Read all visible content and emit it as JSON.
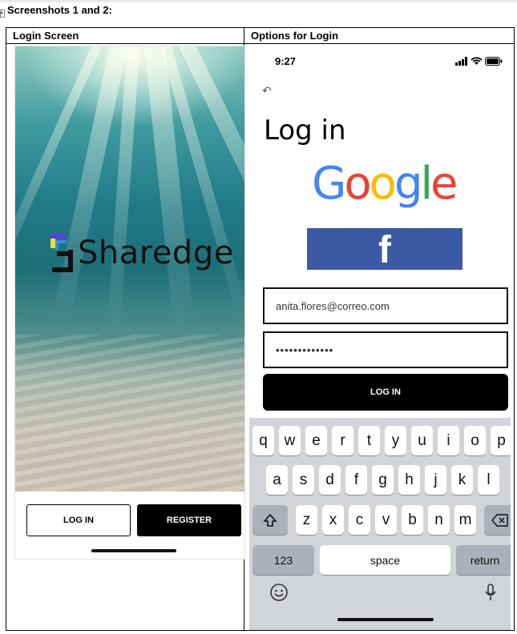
{
  "document": {
    "heading": "Screenshots 1 and 2:",
    "columns": [
      {
        "title": "Login Screen"
      },
      {
        "title": "Options for Login"
      }
    ]
  },
  "screen1": {
    "brand": "Sharedge",
    "login_label": "LOG IN",
    "register_label": "REGISTER",
    "background": "underwater-sea-floor"
  },
  "screen2": {
    "time": "9:27",
    "status_icons": [
      "signal-icon",
      "wifi-icon",
      "battery-icon"
    ],
    "title": "Log in",
    "google_letters": [
      {
        "ch": "G",
        "color": "#4285F4"
      },
      {
        "ch": "o",
        "color": "#EA4335"
      },
      {
        "ch": "o",
        "color": "#FBBC05"
      },
      {
        "ch": "g",
        "color": "#4285F4"
      },
      {
        "ch": "l",
        "color": "#34A853"
      },
      {
        "ch": "e",
        "color": "#EA4335"
      }
    ],
    "facebook_letter": "f",
    "facebook_color": "#3b5aa3",
    "email_value": "anita.flores@correo.com",
    "password_value": "•••••••••••••",
    "login_label": "LOG IN",
    "keyboard": {
      "row1": [
        "q",
        "w",
        "e",
        "r",
        "t",
        "y",
        "u",
        "i",
        "o",
        "p"
      ],
      "row2": [
        "a",
        "s",
        "d",
        "f",
        "g",
        "h",
        "j",
        "k",
        "l"
      ],
      "row3": [
        "z",
        "x",
        "c",
        "v",
        "b",
        "n",
        "m"
      ],
      "numbers": "123",
      "space": "space",
      "return": "return"
    }
  }
}
